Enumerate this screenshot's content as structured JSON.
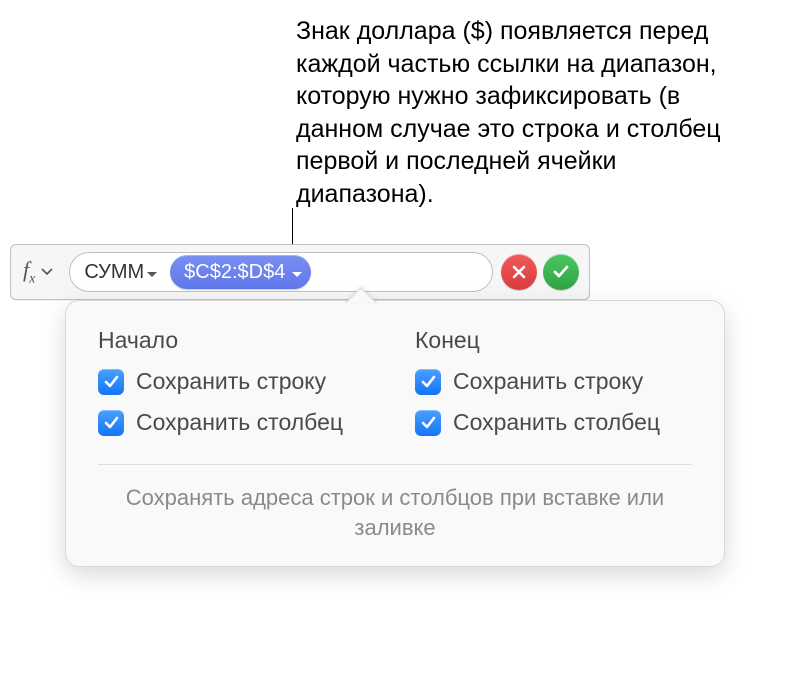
{
  "annotation": "Знак доллара ($) появляется перед каждой частью ссылки на диапазон, которую нужно зафиксировать (в данном случае это строка и столбец первой и последней ячейки диапазона).",
  "formula": {
    "fx_label": "f",
    "fx_sub": "x",
    "function_name": "СУММ",
    "range_ref": "$C$2:$D$4"
  },
  "popover": {
    "start_heading": "Начало",
    "end_heading": "Конец",
    "preserve_row": "Сохранить строку",
    "preserve_col": "Сохранить столбец",
    "footer": "Сохранять адреса строк и столбцов при вставке или заливке",
    "checks": {
      "start_row": true,
      "start_col": true,
      "end_row": true,
      "end_col": true
    }
  }
}
